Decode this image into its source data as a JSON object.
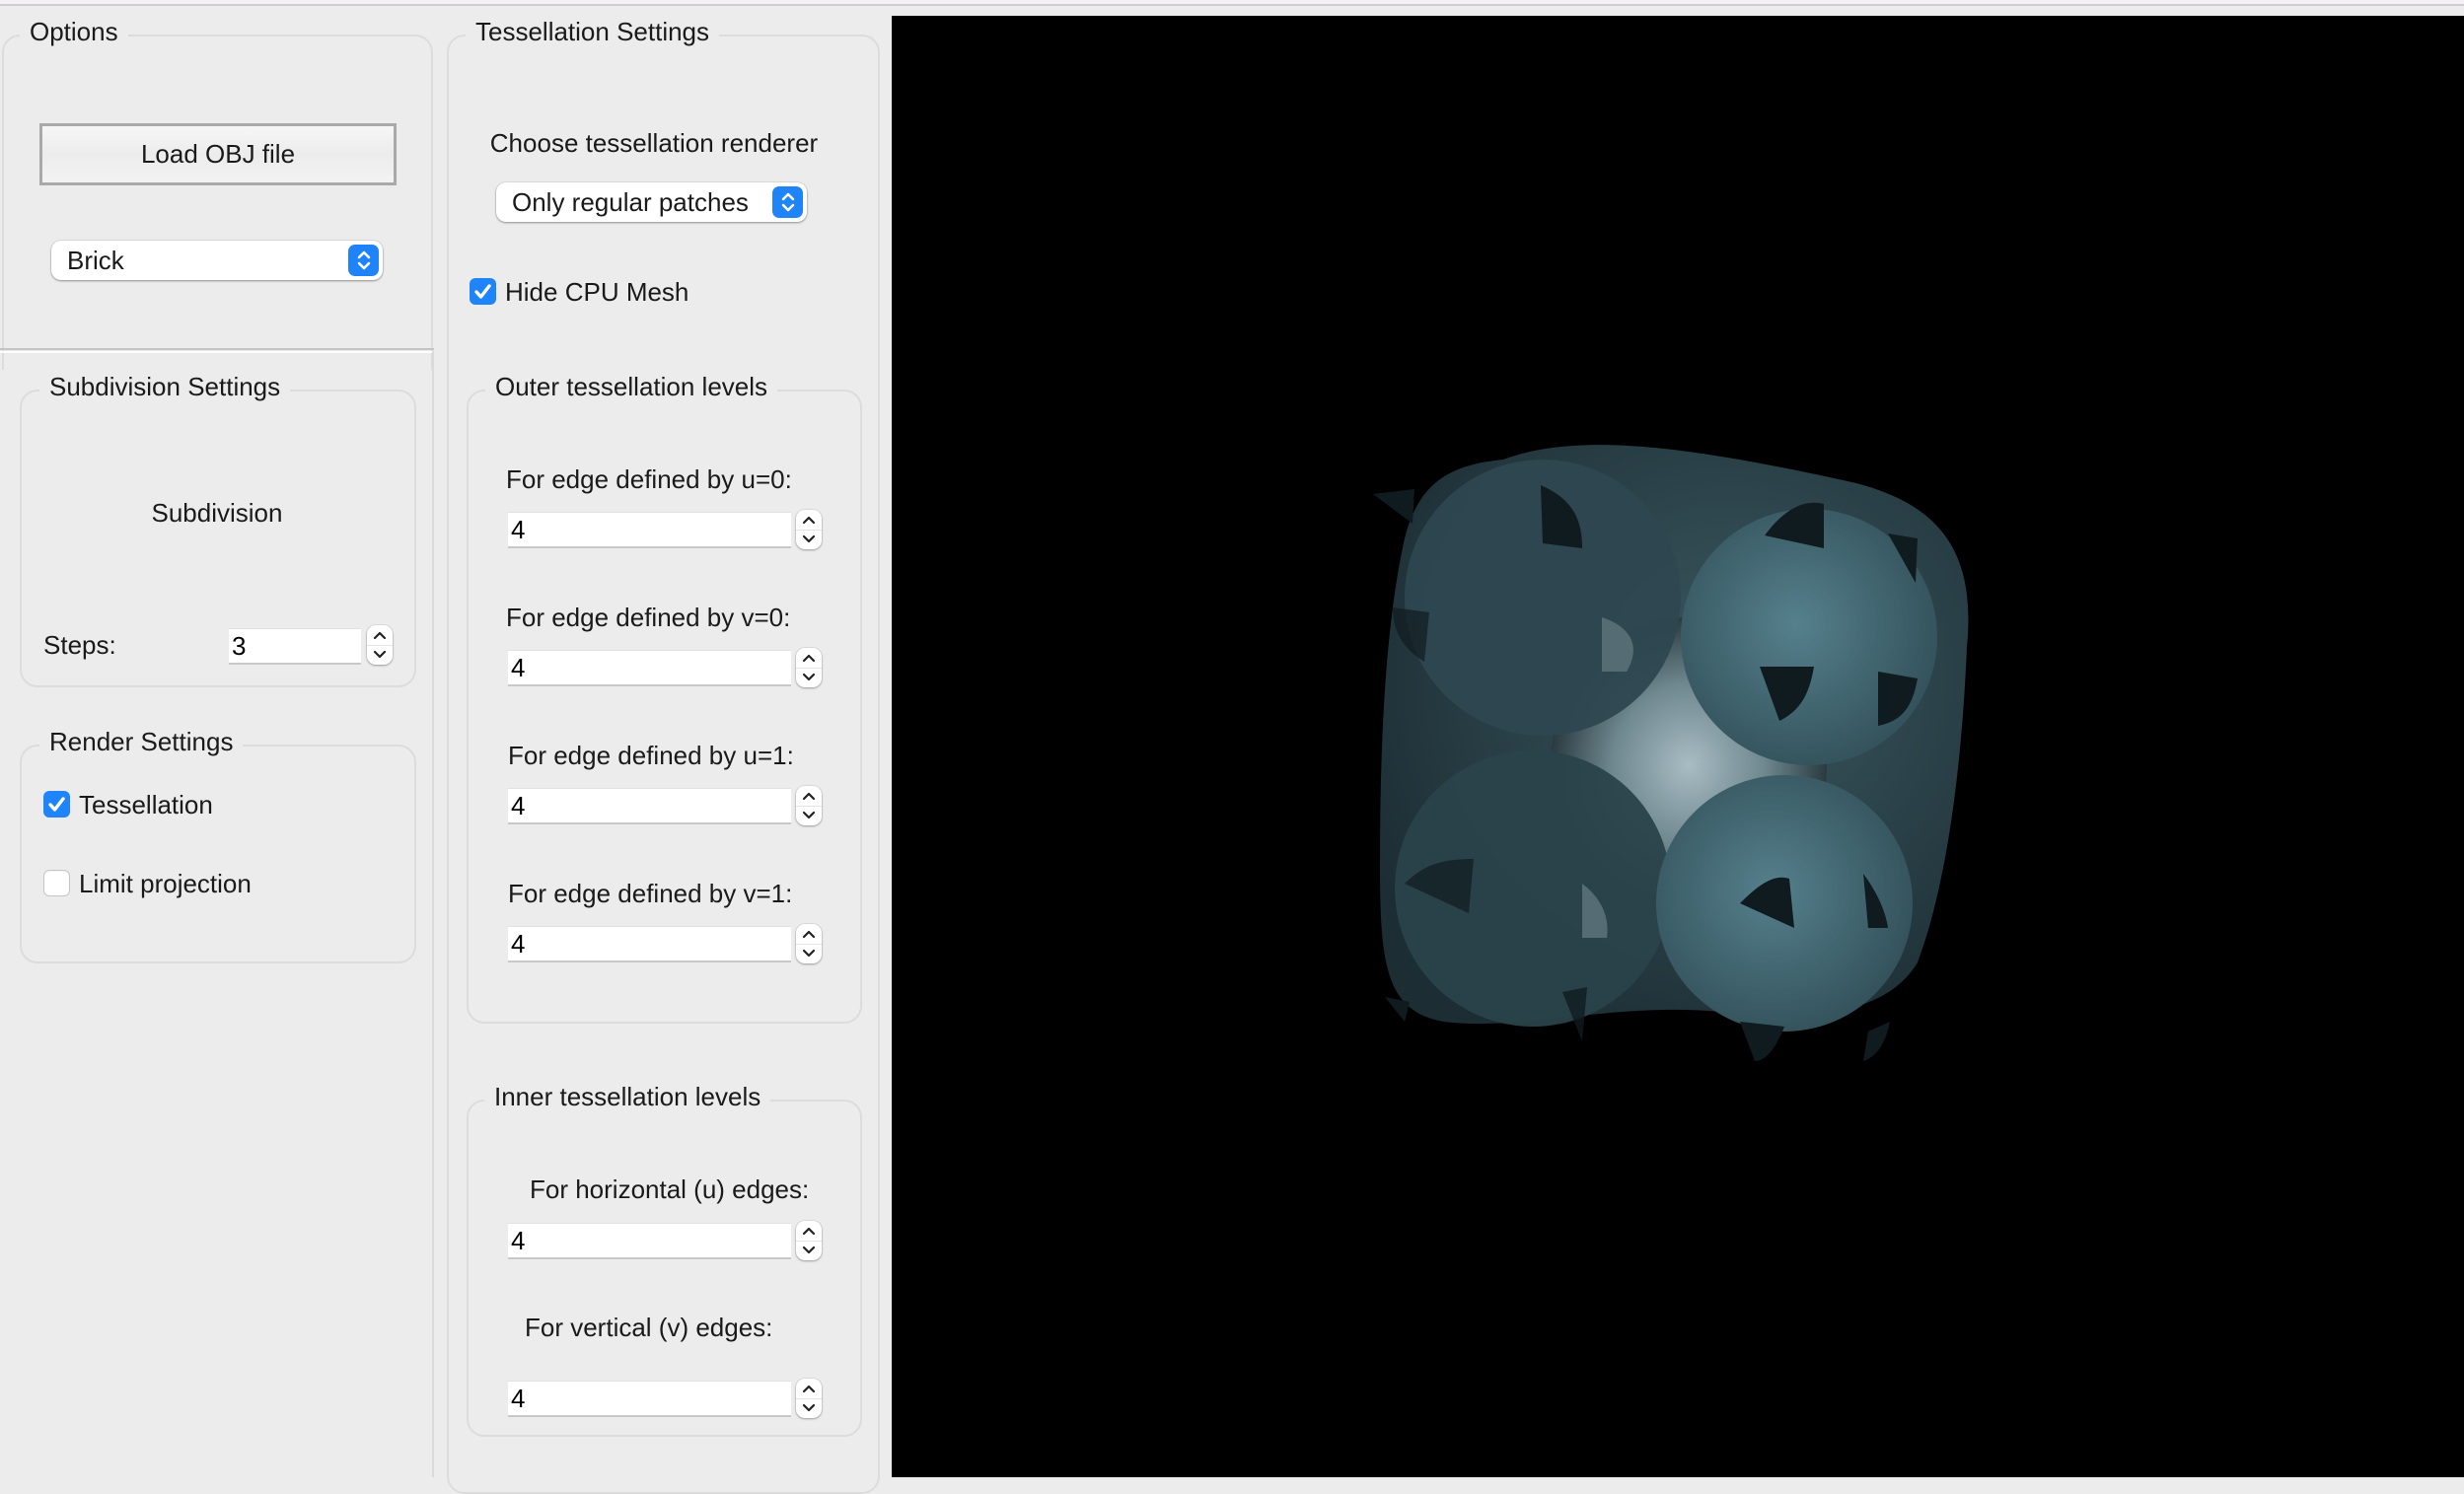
{
  "options": {
    "title": "Options",
    "load_button": "Load OBJ file",
    "model_select": {
      "selected": "Brick"
    }
  },
  "subdivision": {
    "title": "Subdivision Settings",
    "heading": "Subdivision",
    "steps_label": "Steps:",
    "steps_value": "3"
  },
  "render": {
    "title": "Render Settings",
    "tessellation": {
      "label": "Tessellation",
      "checked": true
    },
    "limit_projection": {
      "label": "Limit projection",
      "checked": false
    }
  },
  "tessellation": {
    "title": "Tessellation Settings",
    "renderer_label": "Choose tessellation renderer",
    "renderer_select": {
      "selected": "Only regular patches"
    },
    "hide_cpu_mesh": {
      "label": "Hide CPU Mesh",
      "checked": true
    },
    "outer": {
      "title": "Outer tessellation levels",
      "fields": [
        {
          "label": "For edge defined by u=0:",
          "value": "4"
        },
        {
          "label": "For edge defined by v=0:",
          "value": "4"
        },
        {
          "label": "For edge defined by u=1:",
          "value": "4"
        },
        {
          "label": "For edge defined by v=1:",
          "value": "4"
        }
      ]
    },
    "inner": {
      "title": "Inner tessellation levels",
      "fields": [
        {
          "label": "For horizontal (u) edges:",
          "value": "4"
        },
        {
          "label": "For vertical (v) edges:",
          "value": "4"
        }
      ]
    }
  },
  "viewport": {
    "background": "#000000",
    "model_color": "#4e7a86"
  },
  "colors": {
    "accent": "#1f84f9",
    "panel_bg": "#ececec"
  }
}
